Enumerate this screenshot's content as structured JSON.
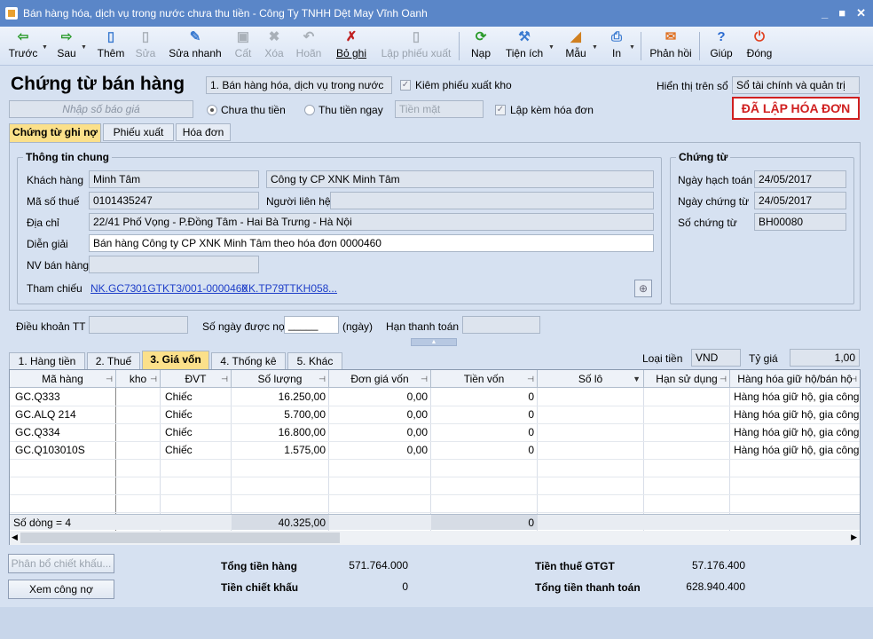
{
  "window": {
    "title": "Bán hàng hóa, dịch vụ trong nước chưa thu tiền - Công Ty TNHH Dệt May Vĩnh Oanh"
  },
  "toolbar": {
    "back": "Trước",
    "next": "Sau",
    "add": "Thêm",
    "edit": "Sửa",
    "quick_edit": "Sửa nhanh",
    "save": "Cất",
    "delete": "Xóa",
    "undo": "Hoãn",
    "unpost": "Bỏ ghi",
    "issue": "Lập phiếu xuất",
    "load": "Nạp",
    "utilities": "Tiện ích",
    "template": "Mẫu",
    "print": "In",
    "feedback": "Phản hồi",
    "help": "Giúp",
    "close": "Đóng"
  },
  "header": {
    "title": "Chứng từ bán hàng",
    "type_select": "1. Bán hàng hóa, dịch vụ trong nước",
    "check_issue": "Kiêm phiếu xuất kho",
    "display_on_label": "Hiển thị trên sổ",
    "display_on_value": "Sổ tài chính và quản trị",
    "quote_placeholder": "Nhập số báo giá",
    "radio_unpaid": "Chưa thu tiền",
    "radio_paid": "Thu tiền ngay",
    "payment_method": "Tiền mặt",
    "check_invoice": "Lập kèm hóa đơn",
    "status_stamp": "ĐÃ LẬP HÓA ĐƠN"
  },
  "tabs": [
    "Chứng từ ghi nợ",
    "Phiếu xuất",
    "Hóa đơn"
  ],
  "general": {
    "group_title": "Thông tin chung",
    "customer_label": "Khách hàng",
    "customer_code": "Minh Tâm",
    "customer_name": "Công ty CP XNK Minh Tâm",
    "tax_label": "Mã số thuế",
    "tax_code": "0101435247",
    "contact_label": "Người liên hệ",
    "contact_value": "",
    "address_label": "Địa chỉ",
    "address": "22/41 Phố Vọng -  P.Đồng Tâm - Hai Bà Trưng - Hà Nội",
    "desc_label": "Diễn giải",
    "description": "Bán hàng Công ty CP XNK Minh Tâm theo hóa đơn 0000460",
    "seller_label": "NV bán hàng",
    "seller": "",
    "ref_label": "Tham chiếu",
    "refs": [
      "NK.GC73",
      "01GTKT3/001-0000460",
      "XK.TP79",
      "TTKH058",
      "..."
    ]
  },
  "voucher": {
    "group_title": "Chứng từ",
    "posting_label": "Ngày hạch toán",
    "posting_date": "24/05/2017",
    "doc_date_label": "Ngày chứng từ",
    "doc_date": "24/05/2017",
    "doc_no_label": "Số chứng từ",
    "doc_no": "BH00080"
  },
  "terms": {
    "term_label": "Điều khoản TT",
    "term_value": "",
    "days_label": "Số ngày được nợ",
    "days_value": "_____",
    "days_unit": "(ngày)",
    "due_label": "Hạn thanh toán",
    "due_value": ""
  },
  "subtabs": [
    "1. Hàng tiền",
    "2. Thuế",
    "3. Giá vốn",
    "4. Thống kê",
    "5. Khác"
  ],
  "currency": {
    "label": "Loại tiền",
    "value": "VND",
    "rate_label": "Tỷ giá",
    "rate": "1,00"
  },
  "grid": {
    "columns": [
      "Mã hàng",
      "kho",
      "ĐVT",
      "Số lượng",
      "Đơn giá vốn",
      "Tiền vốn",
      "Số lô",
      "Hạn sử dụng",
      "Hàng hóa giữ hộ/bán hộ"
    ],
    "rows": [
      {
        "code": "GC.Q333",
        "unit": "Chiếc",
        "qty": "16.250,00",
        "price": "0,00",
        "cost": "0",
        "hold": "Hàng hóa giữ hộ, gia công"
      },
      {
        "code": "GC.ALQ 214",
        "unit": "Chiếc",
        "qty": "5.700,00",
        "price": "0,00",
        "cost": "0",
        "hold": "Hàng hóa giữ hộ, gia công"
      },
      {
        "code": "GC.Q334",
        "unit": "Chiếc",
        "qty": "16.800,00",
        "price": "0,00",
        "cost": "0",
        "hold": "Hàng hóa giữ hộ, gia công"
      },
      {
        "code": "GC.Q103010S",
        "unit": "Chiếc",
        "qty": "1.575,00",
        "price": "0,00",
        "cost": "0",
        "hold": "Hàng hóa giữ hộ, gia công"
      }
    ],
    "footer_count": "Số dòng = 4",
    "footer_qty": "40.325,00",
    "footer_cost": "0"
  },
  "bottom": {
    "discount_btn": "Phân bổ chiết khấu...",
    "debt_btn": "Xem công nợ",
    "total_goods_label": "Tổng tiền hàng",
    "total_goods": "571.764.000",
    "discount_label": "Tiền chiết khấu",
    "discount": "0",
    "vat_label": "Tiền thuế GTGT",
    "vat": "57.176.400",
    "total_pay_label": "Tổng tiền thanh toán",
    "total_pay": "628.940.400"
  }
}
